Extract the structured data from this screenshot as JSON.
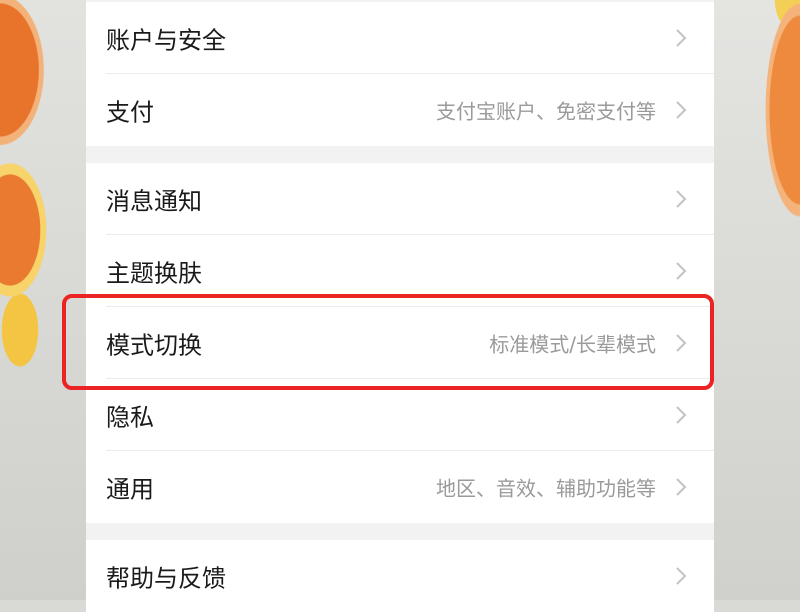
{
  "settings": {
    "groups": [
      {
        "items": [
          {
            "label": "账户与安全",
            "value": ""
          },
          {
            "label": "支付",
            "value": "支付宝账户、免密支付等"
          }
        ]
      },
      {
        "items": [
          {
            "label": "消息通知",
            "value": ""
          },
          {
            "label": "主题换肤",
            "value": ""
          },
          {
            "label": "模式切换",
            "value": "标准模式/长辈模式"
          },
          {
            "label": "隐私",
            "value": ""
          },
          {
            "label": "通用",
            "value": "地区、音效、辅助功能等"
          }
        ]
      },
      {
        "items": [
          {
            "label": "帮助与反馈",
            "value": ""
          }
        ]
      }
    ]
  },
  "colors": {
    "highlight": "#ec2323",
    "text": "#1a1a1a",
    "secondary_text": "#9a9a9a",
    "chevron": "#c3c3c3"
  },
  "icons": {
    "row_arrow": "chevron-right-icon"
  }
}
